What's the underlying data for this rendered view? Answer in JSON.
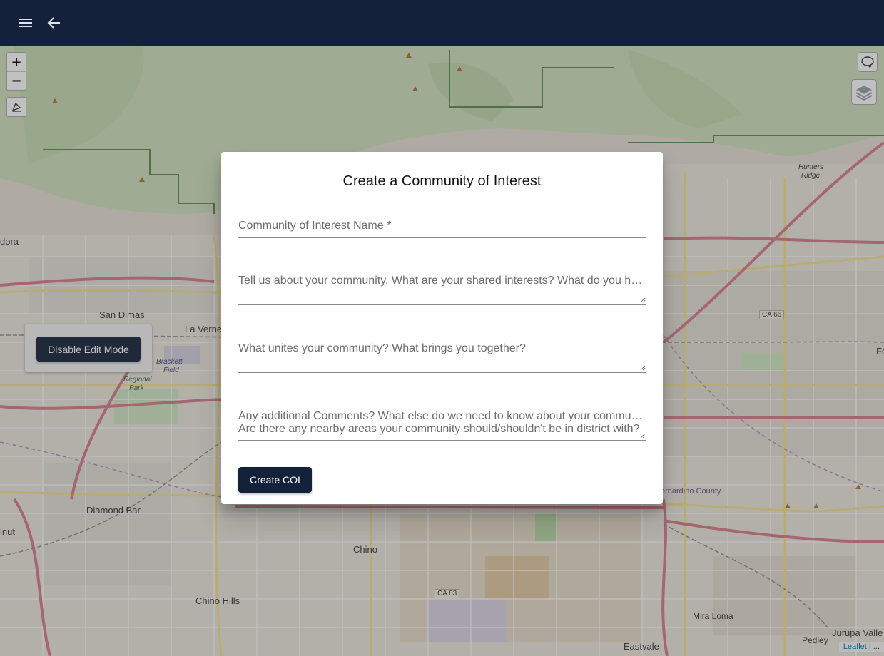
{
  "appbar": {
    "menu_icon": "hamburger-menu-icon",
    "back_icon": "arrow-back-icon",
    "background": "#13213a"
  },
  "map": {
    "zoom_in_label": "+",
    "zoom_out_label": "−",
    "draw_icon": "draw-polygon-icon",
    "lasso_icon": "lasso-icon",
    "layers_icon": "layers-icon",
    "edit_mode_button": "Disable Edit Mode",
    "attribution": {
      "link": "Leaflet",
      "rest": " | ..."
    },
    "labels": [
      {
        "id": "san-dimas",
        "text": "San Dimas"
      },
      {
        "id": "la-verne",
        "text": "La Verne"
      },
      {
        "id": "brackett",
        "text": "Brackett"
      },
      {
        "id": "field",
        "text": "Field"
      },
      {
        "id": "regional",
        "text": "Regional"
      },
      {
        "id": "park",
        "text": "Park"
      },
      {
        "id": "diamond-bar",
        "text": "Diamond Bar"
      },
      {
        "id": "chino",
        "text": "Chino"
      },
      {
        "id": "chino-hills",
        "text": "Chino Hills"
      },
      {
        "id": "eastvale",
        "text": "Eastvale"
      },
      {
        "id": "mira-loma",
        "text": "Mira Loma"
      },
      {
        "id": "pedley",
        "text": "Pedley"
      },
      {
        "id": "jurupa",
        "text": "Jurupa Valle"
      },
      {
        "id": "hunters",
        "text": "Hunters"
      },
      {
        "id": "ridge",
        "text": "Ridge"
      },
      {
        "id": "dora",
        "text": "dora"
      },
      {
        "id": "inut",
        "text": "lnut"
      },
      {
        "id": "fo",
        "text": "Fo"
      },
      {
        "id": "sb-county",
        "text": "ernardino County"
      },
      {
        "id": "ca66",
        "text": "CA 66"
      },
      {
        "id": "ca83",
        "text": "CA 83"
      }
    ]
  },
  "dialog": {
    "title": "Create a Community of Interest",
    "name_field": "Community of Interest Name *",
    "about_field": "Tell us about your community. What are your shared interests? What do you have in common?",
    "unites_field": "What unites your community? What brings you together?",
    "comments_line1": "Any additional Comments? What else do we need to know about your community?",
    "comments_line2": "Are there any nearby areas your community should/shouldn't be in district with?",
    "submit_label": "Create COI"
  }
}
